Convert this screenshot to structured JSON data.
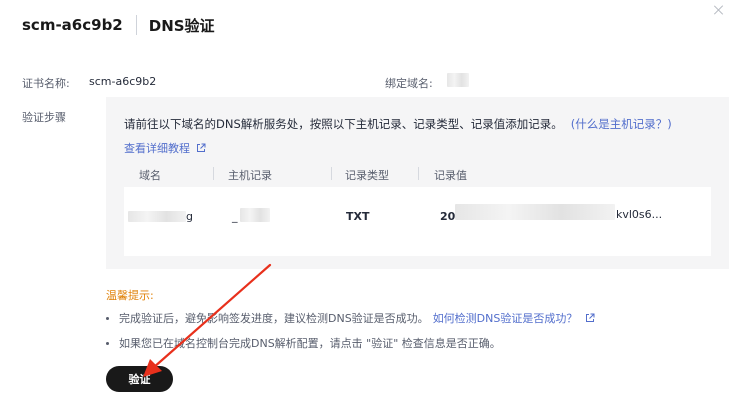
{
  "header": {
    "cert_name": "scm-a6c9b2",
    "title": "DNS验证"
  },
  "fields": {
    "cert_name_label": "证书名称:",
    "cert_name_value": "scm-a6c9b2",
    "bound_domain_label": "绑定域名:",
    "steps_label": "验证步骤"
  },
  "panel": {
    "instruction": "请前往以下域名的DNS解析服务处，按照以下主机记录、记录类型、记录值添加记录。",
    "what_is_host_link": "(什么是主机记录？)",
    "tutorial_link": "查看详细教程"
  },
  "table": {
    "columns": [
      "域名",
      "主机记录",
      "记录类型",
      "记录值"
    ],
    "row": {
      "domain_partial": "g",
      "host_partial": "_",
      "record_type": "TXT",
      "value_prefix": "20",
      "value_suffix": "kvl0s6..."
    }
  },
  "tips": {
    "title": "温馨提示:",
    "tip1": "完成验证后，避免影响签发进度，建议检测DNS验证是否成功。",
    "tip1_link": "如何检测DNS验证是否成功？",
    "tip2": "如果您已在域名控制台完成DNS解析配置，请点击 \"验证\" 检查信息是否正确。"
  },
  "actions": {
    "verify_label": "验证"
  },
  "colors": {
    "link": "#526ecc",
    "warning": "#e0820a",
    "annotation_arrow": "#e8301c",
    "primary_button": "#191919"
  }
}
